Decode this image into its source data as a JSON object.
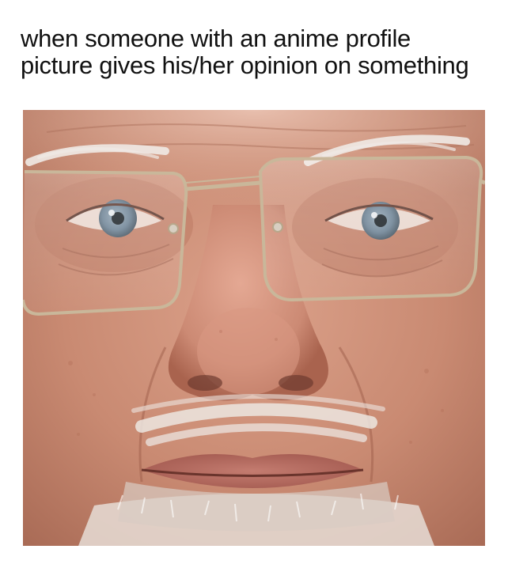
{
  "caption": {
    "line1": "when someone with an anime profile",
    "line2": "picture gives his/her opinion on something"
  },
  "photo": {
    "subject": "close-up-face-with-glasses",
    "colors": {
      "skin": "#c98a72",
      "skin_light": "#e2b29d",
      "skin_shadow": "#a8644f",
      "iris": "#6f8496",
      "hair": "#efeae6",
      "frame": "#c9b79a",
      "lips": "#b3685e"
    }
  }
}
